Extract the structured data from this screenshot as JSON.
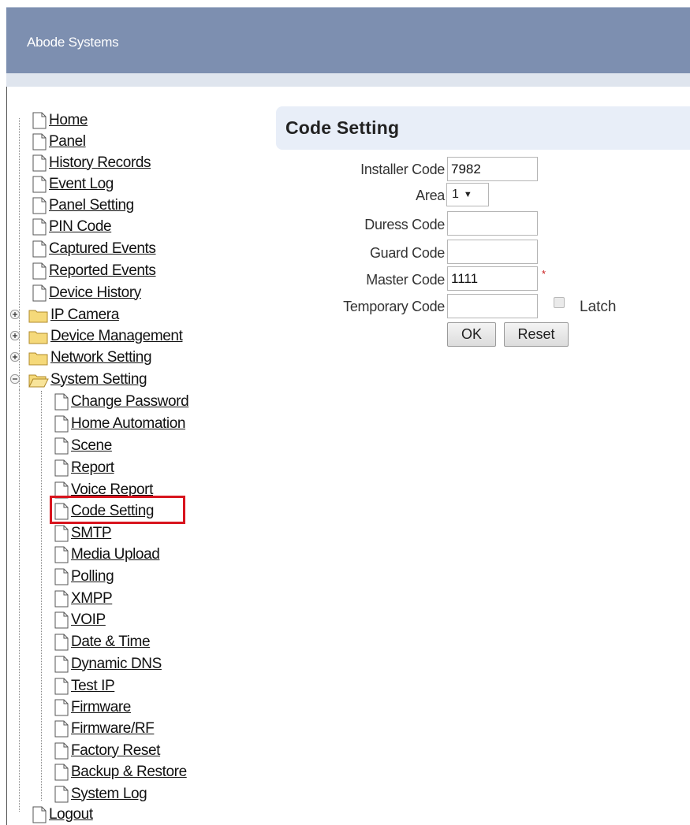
{
  "header": {
    "title": "Abode Systems"
  },
  "nav": {
    "items": [
      {
        "label": "Home"
      },
      {
        "label": "Panel"
      },
      {
        "label": "History Records"
      },
      {
        "label": "Event Log"
      },
      {
        "label": "Panel Setting"
      },
      {
        "label": "PIN Code"
      },
      {
        "label": "Captured Events"
      },
      {
        "label": "Reported Events"
      },
      {
        "label": "Device History"
      }
    ],
    "folders": [
      {
        "label": "IP Camera",
        "state": "collapsed"
      },
      {
        "label": "Device Management",
        "state": "collapsed"
      },
      {
        "label": "Network Setting",
        "state": "collapsed"
      },
      {
        "label": "System Setting",
        "state": "expanded"
      }
    ],
    "system_setting_children": [
      {
        "label": "Change Password"
      },
      {
        "label": "Home Automation"
      },
      {
        "label": "Scene"
      },
      {
        "label": "Report"
      },
      {
        "label": "Voice Report"
      },
      {
        "label": "Code Setting",
        "highlighted": true
      },
      {
        "label": "SMTP"
      },
      {
        "label": "Media Upload"
      },
      {
        "label": "Polling"
      },
      {
        "label": "XMPP"
      },
      {
        "label": "VOIP"
      },
      {
        "label": "Date & Time"
      },
      {
        "label": "Dynamic DNS"
      },
      {
        "label": "Test IP"
      },
      {
        "label": "Firmware"
      },
      {
        "label": "Firmware/RF"
      },
      {
        "label": "Factory Reset"
      },
      {
        "label": "Backup & Restore"
      },
      {
        "label": "System Log"
      }
    ],
    "logout": {
      "label": "Logout"
    }
  },
  "main": {
    "title": "Code Setting",
    "form": {
      "installer_code": {
        "label": "Installer Code",
        "value": "7982"
      },
      "area": {
        "label": "Area",
        "value": "1"
      },
      "duress_code": {
        "label": "Duress Code",
        "value": ""
      },
      "guard_code": {
        "label": "Guard Code",
        "value": ""
      },
      "master_code": {
        "label": "Master Code",
        "value": "1111",
        "required_marker": "*"
      },
      "temporary_code": {
        "label": "Temporary Code",
        "value": ""
      },
      "latch": {
        "label": "Latch",
        "checked": false
      },
      "ok_button": "OK",
      "reset_button": "Reset"
    }
  },
  "colors": {
    "header_bg": "#7d8fb0",
    "title_bar_bg": "#e8eef8",
    "highlight": "#d8141e",
    "required": "#c81818"
  },
  "icons": {
    "page": "document-icon",
    "folder_closed": "folder-icon",
    "folder_open": "folder-open-icon",
    "expand": "plus-expander-icon",
    "collapse": "minus-expander-icon"
  }
}
